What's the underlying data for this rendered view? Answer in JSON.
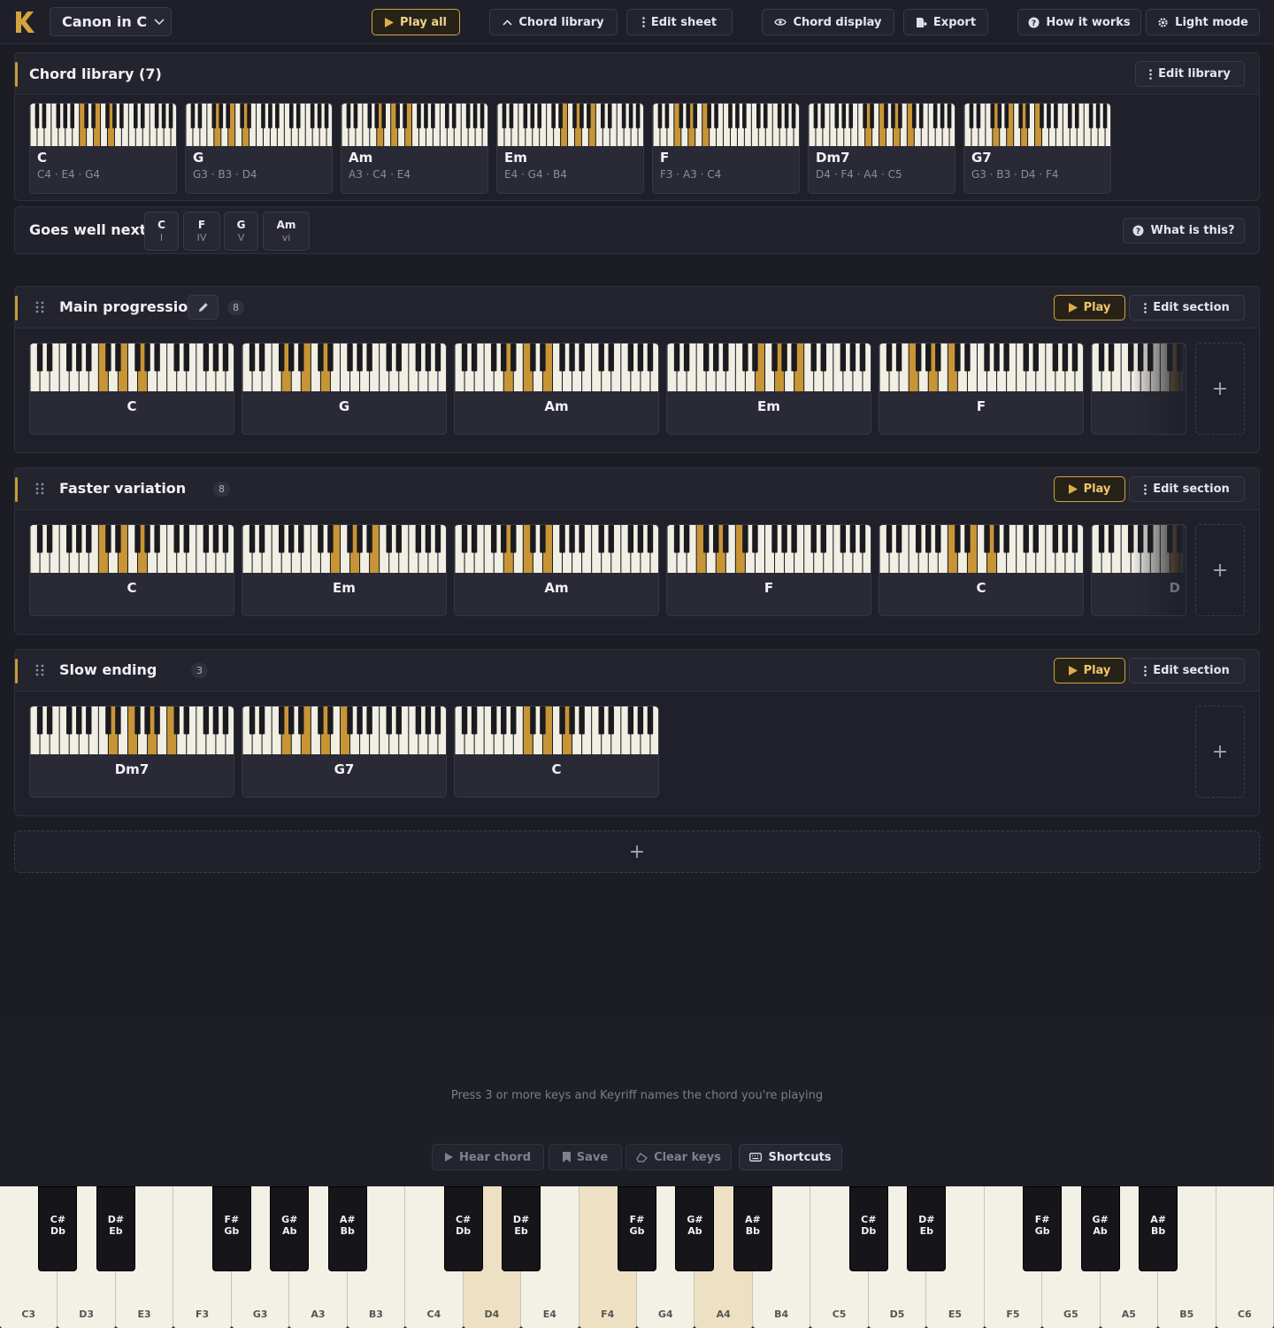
{
  "topbar": {
    "song_title": "Canon in C",
    "play_all": "Play all",
    "chord_library": "Chord library",
    "edit_sheet": "Edit sheet",
    "chord_display": "Chord display",
    "export": "Export",
    "how_it_works": "How it works",
    "light_mode": "Light mode"
  },
  "colors": {
    "accent": "#d3a33f",
    "highlight_key": "#c89536",
    "background": "#1b1c24",
    "panel": "#1f2029"
  },
  "library": {
    "title": "Chord library (7)",
    "edit_label": "Edit library",
    "chords": [
      {
        "name": "C",
        "notes": "C4 · E4 · G4",
        "keys": [
          "C4",
          "E4",
          "G4"
        ]
      },
      {
        "name": "G",
        "notes": "G3 · B3 · D4",
        "keys": [
          "G3",
          "B3",
          "D4"
        ]
      },
      {
        "name": "Am",
        "notes": "A3 · C4 · E4",
        "keys": [
          "A3",
          "C4",
          "E4"
        ]
      },
      {
        "name": "Em",
        "notes": "E4 · G4 · B4",
        "keys": [
          "E4",
          "G4",
          "B4"
        ]
      },
      {
        "name": "F",
        "notes": "F3 · A3 · C4",
        "keys": [
          "F3",
          "A3",
          "C4"
        ]
      },
      {
        "name": "Dm7",
        "notes": "D4 · F4 · A4 · C5",
        "keys": [
          "D4",
          "F4",
          "A4",
          "C5"
        ]
      },
      {
        "name": "G7",
        "notes": "G3 · B3 · D4 · F4",
        "keys": [
          "G3",
          "B3",
          "D4",
          "F4"
        ]
      }
    ]
  },
  "goes_well_next": {
    "label": "Goes well next",
    "what_is_this": "What is this?",
    "chips": [
      {
        "name": "C",
        "roman": "I"
      },
      {
        "name": "F",
        "roman": "IV"
      },
      {
        "name": "G",
        "roman": "V"
      },
      {
        "name": "Am",
        "roman": "vi"
      }
    ]
  },
  "sections": [
    {
      "title": "Main progression",
      "count": "8",
      "play_label": "Play",
      "edit_label": "Edit section",
      "chords": [
        "C",
        "G",
        "Am",
        "Em",
        "F",
        ""
      ]
    },
    {
      "title": "Faster variation",
      "count": "8",
      "play_label": "Play",
      "edit_label": "Edit section",
      "chords": [
        "C",
        "Em",
        "Am",
        "F",
        "C",
        "D"
      ]
    },
    {
      "title": "Slow ending",
      "count": "3",
      "play_label": "Play",
      "edit_label": "Edit section",
      "chords": [
        "Dm7",
        "G7",
        "C"
      ]
    }
  ],
  "add_symbol": "+",
  "hint": "Press 3 or more keys and Keyriff names the chord you're playing",
  "bottom_buttons": {
    "hear_chord": "Hear chord",
    "save": "Save",
    "clear_keys": "Clear keys",
    "shortcuts": "Shortcuts"
  },
  "keyboard": {
    "white_keys": [
      "C3",
      "D3",
      "E3",
      "F3",
      "G3",
      "A3",
      "B3",
      "C4",
      "D4",
      "E4",
      "F4",
      "G4",
      "A4",
      "B4",
      "C5",
      "D5",
      "E5",
      "F5",
      "G5",
      "A5",
      "B5",
      "C6"
    ],
    "black_keys": [
      "C#\nDb",
      "D#\nEb",
      "F#\nGb",
      "G#\nAb",
      "A#\nBb",
      "C#\nDb",
      "D#\nEb",
      "F#\nGb",
      "G#\nAb",
      "A#\nBb",
      "C#\nDb",
      "D#\nEb",
      "F#\nGb",
      "G#\nAb",
      "A#\nBb"
    ],
    "pressed": [
      "D4",
      "F4",
      "A4"
    ]
  }
}
